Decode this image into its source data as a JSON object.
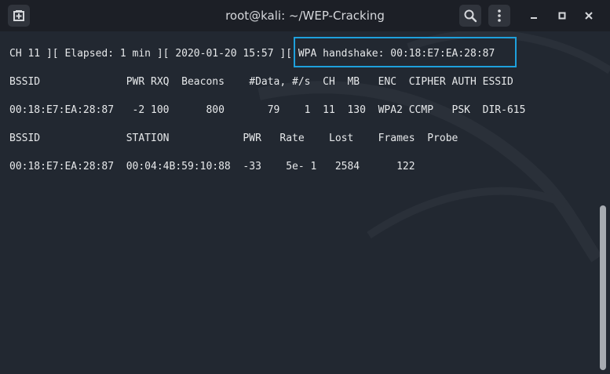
{
  "window": {
    "title": "root@kali: ~/WEP-Cracking"
  },
  "titlebar_icons": {
    "new_tab": "new-tab-icon",
    "search": "search-icon",
    "menu": "menu-dots-icon",
    "minimize": "minimize-icon",
    "maximize": "maximize-icon",
    "close": "close-icon"
  },
  "terminal": {
    "status_line": "CH 11 ][ Elapsed: 1 min ][ 2020-01-20 15:57 ][ WPA handshake: 00:18:E7:EA:28:87",
    "ap_header": "BSSID              PWR RXQ  Beacons    #Data, #/s  CH  MB   ENC  CIPHER AUTH ESSID",
    "ap_row": "00:18:E7:EA:28:87   -2 100      800       79    1  11  130  WPA2 CCMP   PSK  DIR-615",
    "station_header": "BSSID              STATION            PWR   Rate    Lost    Frames  Probe",
    "station_row": "00:18:E7:EA:28:87  00:04:4B:59:10:88  -33    5e- 1   2584      122"
  },
  "colors": {
    "background": "#222831",
    "titlebar": "#1c1f26",
    "text": "#e6e8ea",
    "highlight_border": "#1ea0dc"
  }
}
